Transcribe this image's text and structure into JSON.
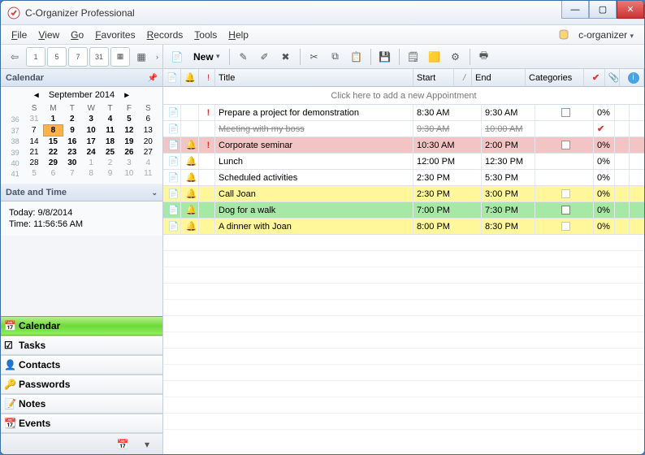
{
  "window_title": "C-Organizer Professional",
  "menu": [
    "File",
    "View",
    "Go",
    "Favorites",
    "Records",
    "Tools",
    "Help"
  ],
  "db_label": "c-organizer",
  "sidebar_toolbar_icons": [
    "nav-back",
    "view-day",
    "view-5day",
    "view-7day",
    "view-31",
    "view-month",
    "view-more"
  ],
  "main_toolbar": {
    "new_label": "New",
    "icons_left": [
      "doc-new"
    ],
    "icons_mid": [
      "edit",
      "edit2",
      "delete",
      "cut",
      "copy",
      "paste",
      "save",
      "note",
      "highlight",
      "filter",
      "print"
    ]
  },
  "panels": {
    "calendar_title": "Calendar",
    "datetime_title": "Date and Time",
    "today_lbl": "Today: 9/8/2014",
    "time_lbl": "Time: 11:56:56 AM"
  },
  "calendar": {
    "month_label": "September 2014",
    "dow": [
      "S",
      "M",
      "T",
      "W",
      "T",
      "F",
      "S"
    ],
    "weeks": [
      {
        "wk": "36",
        "days": [
          {
            "d": "31",
            "out": true
          },
          {
            "d": "1",
            "bold": true
          },
          {
            "d": "2",
            "bold": true
          },
          {
            "d": "3",
            "bold": true
          },
          {
            "d": "4",
            "bold": true
          },
          {
            "d": "5",
            "bold": true
          },
          {
            "d": "6"
          }
        ]
      },
      {
        "wk": "37",
        "days": [
          {
            "d": "7"
          },
          {
            "d": "8",
            "today": true,
            "bold": true
          },
          {
            "d": "9",
            "bold": true
          },
          {
            "d": "10",
            "bold": true
          },
          {
            "d": "11",
            "bold": true
          },
          {
            "d": "12",
            "bold": true
          },
          {
            "d": "13"
          }
        ]
      },
      {
        "wk": "38",
        "days": [
          {
            "d": "14"
          },
          {
            "d": "15",
            "bold": true
          },
          {
            "d": "16",
            "bold": true
          },
          {
            "d": "17",
            "bold": true
          },
          {
            "d": "18",
            "bold": true
          },
          {
            "d": "19",
            "bold": true
          },
          {
            "d": "20"
          }
        ]
      },
      {
        "wk": "39",
        "days": [
          {
            "d": "21"
          },
          {
            "d": "22",
            "bold": true
          },
          {
            "d": "23",
            "bold": true
          },
          {
            "d": "24",
            "bold": true
          },
          {
            "d": "25",
            "bold": true
          },
          {
            "d": "26",
            "bold": true
          },
          {
            "d": "27"
          }
        ]
      },
      {
        "wk": "40",
        "days": [
          {
            "d": "28"
          },
          {
            "d": "29",
            "bold": true
          },
          {
            "d": "30",
            "bold": true
          },
          {
            "d": "1",
            "out": true
          },
          {
            "d": "2",
            "out": true
          },
          {
            "d": "3",
            "out": true
          },
          {
            "d": "4",
            "out": true
          }
        ]
      },
      {
        "wk": "41",
        "days": [
          {
            "d": "5",
            "out": true
          },
          {
            "d": "6",
            "out": true
          },
          {
            "d": "7",
            "out": true
          },
          {
            "d": "8",
            "out": true
          },
          {
            "d": "9",
            "out": true
          },
          {
            "d": "10",
            "out": true
          },
          {
            "d": "11",
            "out": true
          }
        ]
      }
    ]
  },
  "nav_items": [
    {
      "label": "Calendar",
      "active": true,
      "icon": "calendar-icon"
    },
    {
      "label": "Tasks",
      "icon": "tasks-icon"
    },
    {
      "label": "Contacts",
      "icon": "contacts-icon"
    },
    {
      "label": "Passwords",
      "icon": "passwords-icon"
    },
    {
      "label": "Notes",
      "icon": "notes-icon"
    },
    {
      "label": "Events",
      "icon": "events-icon"
    }
  ],
  "columns": {
    "title": "Title",
    "start": "Start",
    "end": "End",
    "categories": "Categories"
  },
  "col_widths": {
    "icon1": 22,
    "icon2": 22,
    "priority": 20,
    "title": 244,
    "start": 62,
    "sortdir": 10,
    "end": 66,
    "categories": 72,
    "check": 26,
    "attach": 18,
    "info": 20
  },
  "add_row_text": "Click here to add a new Appointment",
  "percent_label": "0%",
  "rows": [
    {
      "title": "Prepare a project for demonstration",
      "start": "8:30 AM",
      "end": "9:30 AM",
      "cat": "box-red",
      "pct": "0%",
      "color": "",
      "priority": true,
      "doc": true
    },
    {
      "title": "Meeting with my boss",
      "start": "9:30 AM",
      "end": "10:00 AM",
      "check": true,
      "strike": true,
      "doc": true,
      "color": ""
    },
    {
      "title": "Corporate seminar",
      "start": "10:30 AM",
      "end": "2:00 PM",
      "cat": "box-red",
      "pct": "0%",
      "color": "red",
      "priority": true,
      "doc": true,
      "bell": true
    },
    {
      "title": "Lunch",
      "start": "12:00 PM",
      "end": "12:30 PM",
      "pct": "0%",
      "color": "",
      "doc": true,
      "bell": true
    },
    {
      "title": "Scheduled activities",
      "start": "2:30 PM",
      "end": "5:30 PM",
      "pct": "0%",
      "color": "",
      "doc": true,
      "bell": true
    },
    {
      "title": "Call Joan",
      "start": "2:30 PM",
      "end": "3:00 PM",
      "cat": "box-yellow",
      "pct": "0%",
      "color": "yellow",
      "doc": true,
      "bell": true
    },
    {
      "title": "Dog for a walk",
      "start": "7:00 PM",
      "end": "7:30 PM",
      "cat": "box-green",
      "pct": "0%",
      "color": "green",
      "doc": true,
      "bell": true
    },
    {
      "title": "A dinner with Joan",
      "start": "8:00 PM",
      "end": "8:30 PM",
      "cat": "box-yellow",
      "pct": "0%",
      "color": "yellow",
      "doc": true,
      "bell": true
    }
  ]
}
